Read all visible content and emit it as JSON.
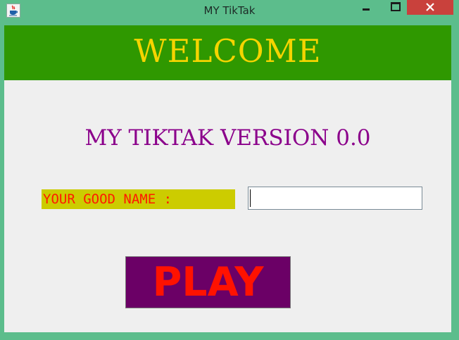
{
  "window": {
    "title": "MY TikTak",
    "icon": "java-cup-icon",
    "controls": [
      "minimize-icon",
      "maximize-icon",
      "close-icon"
    ]
  },
  "header": {
    "welcome_text": "WELCOME",
    "background_color": "#2f9800",
    "text_color": "#f5d400"
  },
  "main": {
    "version_text": "MY TIKTAK VERSION 0.0",
    "version_color": "#8b008b",
    "name_label": "YOUR GOOD NAME :",
    "name_value": "",
    "play_label": "PLAY",
    "play_bg_color": "#6b0066",
    "play_text_color": "#ff1200"
  }
}
